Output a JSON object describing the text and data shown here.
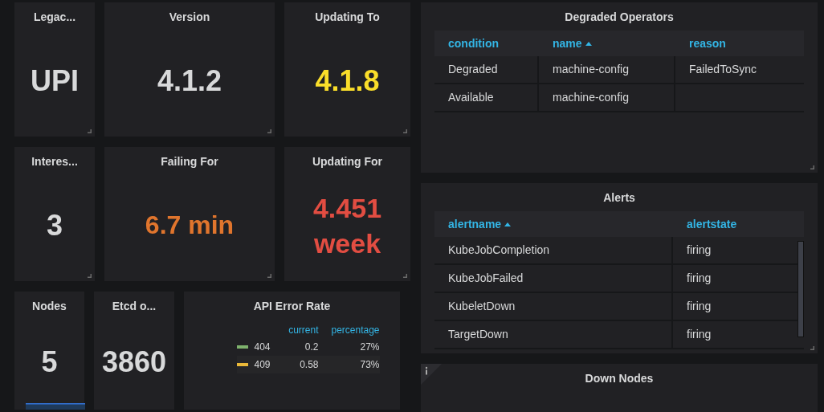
{
  "stats": [
    {
      "title": "Legac...",
      "value": "UPI",
      "color": "#d8d9da"
    },
    {
      "title": "Version",
      "value": "4.1.2",
      "color": "#d8d9da"
    },
    {
      "title": "Updating To",
      "value": "4.1.8",
      "color": "#fade2a"
    },
    {
      "title": "Interes...",
      "value": "3",
      "color": "#d8d9da"
    },
    {
      "title": "Failing For",
      "value": "6.7 min",
      "color": "#e0752d"
    },
    {
      "title": "Updating For",
      "value": "4.451 week",
      "color": "#e24d42"
    },
    {
      "title": "Nodes",
      "value": "5",
      "color": "#d8d9da"
    },
    {
      "title": "Etcd o...",
      "value": "3860",
      "color": "#d8d9da"
    }
  ],
  "api_error_rate": {
    "title": "API Error Rate",
    "columns": [
      "current",
      "percentage"
    ],
    "series": [
      {
        "name": "404",
        "color": "#7eb26d",
        "current": "0.2",
        "percentage": "27%"
      },
      {
        "name": "409",
        "color": "#eab839",
        "current": "0.58",
        "percentage": "73%"
      }
    ]
  },
  "degraded_operators": {
    "title": "Degraded Operators",
    "columns": [
      {
        "label": "condition",
        "sorted": false
      },
      {
        "label": "name",
        "sorted": true
      },
      {
        "label": "reason",
        "sorted": false
      }
    ],
    "rows": [
      [
        "Degraded",
        "machine-config",
        "FailedToSync"
      ],
      [
        "Available",
        "machine-config",
        ""
      ]
    ]
  },
  "alerts": {
    "title": "Alerts",
    "columns": [
      {
        "label": "alertname",
        "sorted": true
      },
      {
        "label": "alertstate",
        "sorted": false
      }
    ],
    "rows": [
      [
        "KubeJobCompletion",
        "firing"
      ],
      [
        "KubeJobFailed",
        "firing"
      ],
      [
        "KubeletDown",
        "firing"
      ],
      [
        "TargetDown",
        "firing"
      ]
    ]
  },
  "down_nodes": {
    "title": "Down Nodes"
  }
}
